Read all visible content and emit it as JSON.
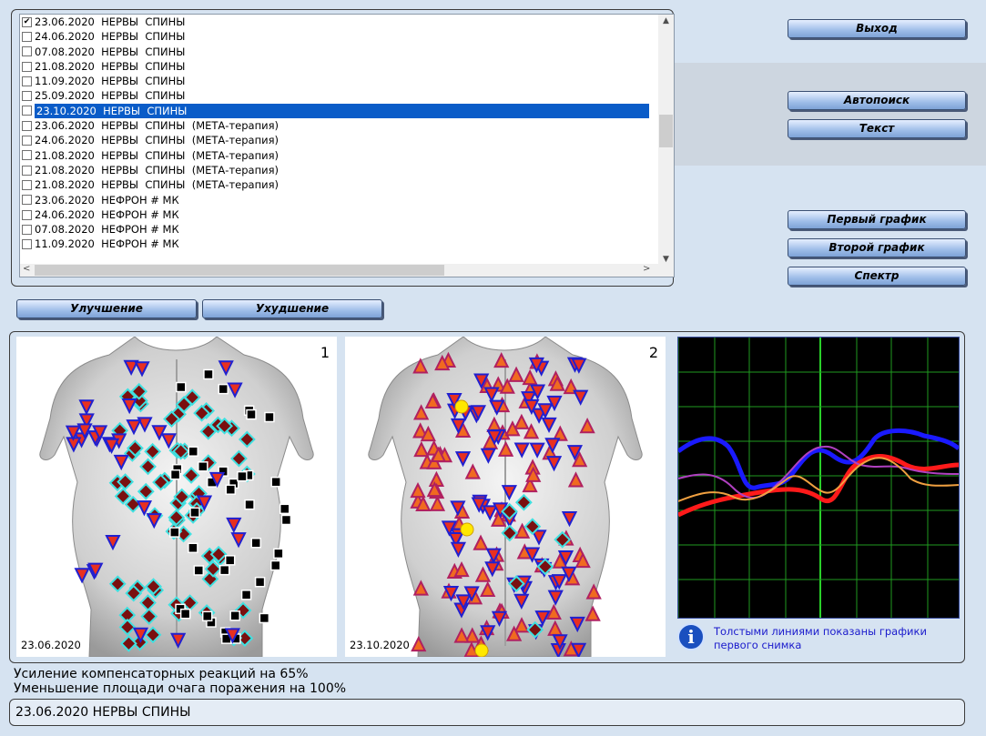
{
  "list": {
    "items": [
      {
        "text": "23.06.2020  НЕРВЫ  СПИНЫ",
        "checked": true
      },
      {
        "text": "24.06.2020  НЕРВЫ  СПИНЫ",
        "checked": false
      },
      {
        "text": "07.08.2020  НЕРВЫ  СПИНЫ",
        "checked": false
      },
      {
        "text": "21.08.2020  НЕРВЫ  СПИНЫ",
        "checked": false
      },
      {
        "text": "11.09.2020  НЕРВЫ  СПИНЫ",
        "checked": false
      },
      {
        "text": "25.09.2020  НЕРВЫ  СПИНЫ",
        "checked": false
      },
      {
        "text": "23.10.2020  НЕРВЫ  СПИНЫ",
        "checked": false,
        "selected": true
      },
      {
        "text": "23.06.2020  НЕРВЫ  СПИНЫ  (МЕТА-терапия)",
        "checked": false
      },
      {
        "text": "24.06.2020  НЕРВЫ  СПИНЫ  (МЕТА-терапия)",
        "checked": false
      },
      {
        "text": "21.08.2020  НЕРВЫ  СПИНЫ  (МЕТА-терапия)",
        "checked": false
      },
      {
        "text": "21.08.2020  НЕРВЫ  СПИНЫ  (МЕТА-терапия)",
        "checked": false
      },
      {
        "text": "21.08.2020  НЕРВЫ  СПИНЫ  (МЕТА-терапия)",
        "checked": false
      },
      {
        "text": "23.06.2020  НЕФРОН # МК",
        "checked": false
      },
      {
        "text": "24.06.2020  НЕФРОН # МК",
        "checked": false
      },
      {
        "text": "07.08.2020  НЕФРОН # МК",
        "checked": false
      },
      {
        "text": "11.09.2020  НЕФРОН # МК",
        "checked": false
      }
    ]
  },
  "buttons": {
    "exit": "Выход",
    "autosearch": "Автопоиск",
    "text": "Текст",
    "first_graph": "Первый график",
    "second_graph": "Второй график",
    "spectrum": "Спектр",
    "improvement": "Улучшение",
    "worsening": "Ухудшение"
  },
  "images": {
    "first": {
      "number": "1",
      "date": "23.06.2020"
    },
    "second": {
      "number": "2",
      "date": "23.10.2020"
    }
  },
  "info": {
    "text_line1": "Толстыми линиями показаны графики",
    "text_line2": "первого снимка"
  },
  "status": {
    "line1": "Усиление компенсаторных реакций на 65%",
    "line2": "Уменьшение площади очага поражения на 100%"
  },
  "bottom": {
    "value": "23.06.2020 НЕРВЫ  СПИНЫ"
  },
  "colors": {
    "background": "#d6e3f1",
    "selection": "#0a5cc8",
    "graph_blue": "#1a1aff",
    "graph_red": "#ff1a1a",
    "graph_violet": "#b040c0",
    "graph_orange": "#f0a040",
    "graph_grid": "#1f9a1f"
  }
}
